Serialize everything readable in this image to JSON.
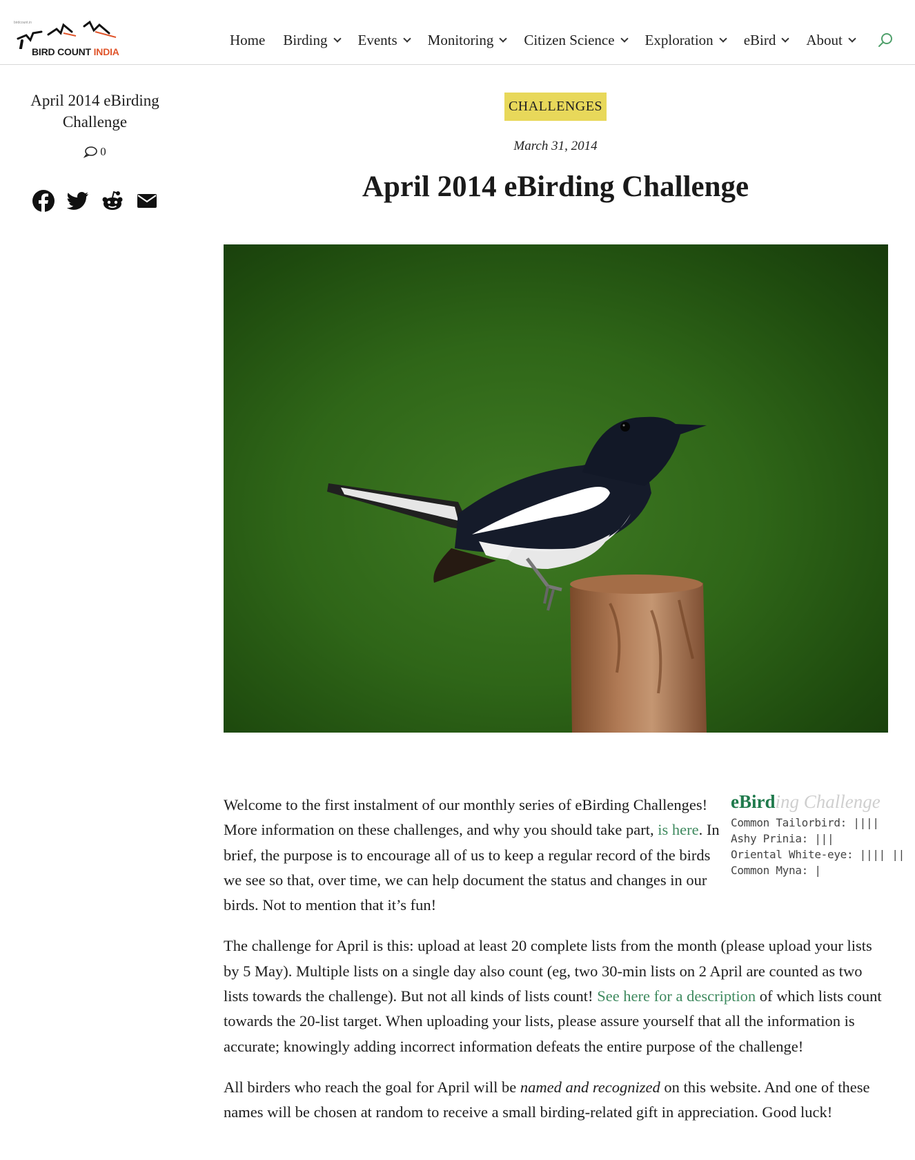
{
  "header": {
    "logo_small": "birdcount.in",
    "logo_bird": "BIRD COUNT",
    "logo_india": "INDIA",
    "nav": [
      {
        "label": "Home",
        "has_dropdown": false
      },
      {
        "label": "Birding",
        "has_dropdown": true
      },
      {
        "label": "Events",
        "has_dropdown": true
      },
      {
        "label": "Monitoring",
        "has_dropdown": true
      },
      {
        "label": "Citizen Science",
        "has_dropdown": true
      },
      {
        "label": "Exploration",
        "has_dropdown": true
      },
      {
        "label": "eBird",
        "has_dropdown": true
      },
      {
        "label": "About",
        "has_dropdown": true
      }
    ],
    "search_icon": "search-icon"
  },
  "sidebar": {
    "title": "April 2014 eBirding Challenge",
    "comment_count": "0",
    "share_icons": [
      "facebook-icon",
      "twitter-icon",
      "reddit-icon",
      "email-icon"
    ]
  },
  "post": {
    "category": "CHALLENGES",
    "date": "March 31, 2014",
    "title": "April 2014 eBirding Challenge",
    "image_subject": "Oriental Magpie-Robin perched on a rusty post"
  },
  "inset": {
    "title_bold": "eBird",
    "title_faded": "ing Challenge",
    "lines": [
      "Common Tailorbird: ||||",
      "Ashy Prinia: |||",
      "Oriental White-eye: |||| ||",
      "Common Myna: |"
    ]
  },
  "content": {
    "p1_a": "Welcome to the first instalment of our monthly series of eBirding Challenges! More information on these challenges, and why you should take part, ",
    "p1_link": "is here",
    "p1_b": ". In brief, the purpose is to encourage all of us to keep a regular record of the birds we see so that, over time, we can help document the status and changes in our birds. Not to mention that it’s fun!",
    "p2_a": "The challenge for April is this: upload at least 20 complete lists from the month (please upload your lists by 5 May). Multiple lists on a single day also count (eg, two 30-min lists on 2 April are counted as two lists towards the challenge). But not all kinds of lists count! ",
    "p2_link": "See here for a description",
    "p2_b": " of which lists count towards the 20-list target. When uploading your lists, please assure yourself that all the information is accurate; knowingly adding incorrect information defeats the entire purpose of the challenge!",
    "p3_a": "All birders who reach the goal for April will be ",
    "p3_em": "named and recognized",
    "p3_b": " on this website. And one of these names will be chosen at random to receive a small birding-related gift in appreciation. Good luck!"
  },
  "colors": {
    "badge_bg": "#e8d85a",
    "link": "#3f8a5f",
    "logo_accent": "#e0552b"
  }
}
